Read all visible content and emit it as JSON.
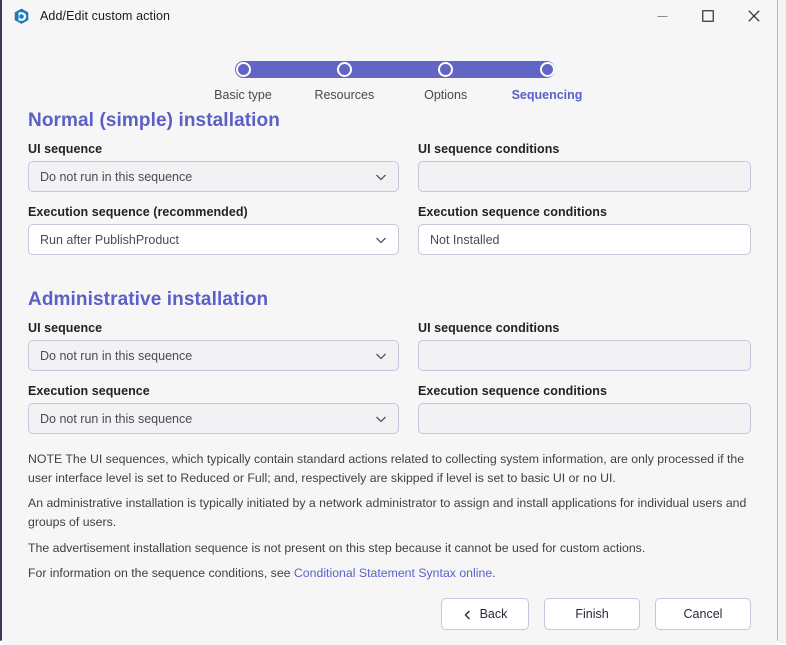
{
  "window": {
    "title": "Add/Edit custom action",
    "app_icon": "app-logo-icon",
    "controls": {
      "minimize": "minimize-icon",
      "maximize": "maximize-icon",
      "close": "close-icon"
    }
  },
  "stepper": {
    "steps": [
      {
        "label": "Basic type",
        "active": false
      },
      {
        "label": "Resources",
        "active": false
      },
      {
        "label": "Options",
        "active": false
      },
      {
        "label": "Sequencing",
        "active": true
      }
    ],
    "bar_color": "#6265c6",
    "active_color": "#5b5fc7"
  },
  "sections": [
    {
      "title": "Normal (simple) installation",
      "fields": [
        {
          "label": "UI sequence",
          "type": "dropdown",
          "value": "Do not run in this sequence",
          "filled": false,
          "name": "normal-ui-sequence-dropdown"
        },
        {
          "label": "UI sequence conditions",
          "type": "text",
          "value": "",
          "filled": false,
          "name": "normal-ui-sequence-conditions-input"
        },
        {
          "label": "Execution sequence (recommended)",
          "type": "dropdown",
          "value": "Run after PublishProduct",
          "filled": true,
          "name": "normal-execution-sequence-dropdown"
        },
        {
          "label": "Execution sequence conditions",
          "type": "text",
          "value": "Not Installed",
          "filled": true,
          "name": "normal-execution-sequence-conditions-input"
        }
      ]
    },
    {
      "title": "Administrative installation",
      "fields": [
        {
          "label": "UI sequence",
          "type": "dropdown",
          "value": "Do not run in this sequence",
          "filled": false,
          "name": "admin-ui-sequence-dropdown"
        },
        {
          "label": "UI sequence conditions",
          "type": "text",
          "value": "",
          "filled": false,
          "name": "admin-ui-sequence-conditions-input"
        },
        {
          "label": "Execution sequence",
          "type": "dropdown",
          "value": "Do not run in this sequence",
          "filled": false,
          "name": "admin-execution-sequence-dropdown"
        },
        {
          "label": "Execution sequence conditions",
          "type": "text",
          "value": "",
          "filled": false,
          "name": "admin-execution-sequence-conditions-input"
        }
      ]
    }
  ],
  "notes": {
    "line1": "NOTE The UI sequences, which typically contain standard actions related to collecting system information, are only processed if the user interface level is set to Reduced or Full; and, respectively are skipped if level is set to basic UI or no UI.",
    "line2": "An administrative installation is typically initiated by a network administrator to assign and install applications for individual users and groups of users.",
    "line3": "The advertisement installation sequence is not present on this step because it cannot be used for custom actions.",
    "line4_prefix": "For information on the sequence conditions, see ",
    "line4_link": "Conditional Statement Syntax online",
    "line4_suffix": "."
  },
  "footer": {
    "back_label": "Back",
    "finish_label": "Finish",
    "cancel_label": "Cancel"
  }
}
